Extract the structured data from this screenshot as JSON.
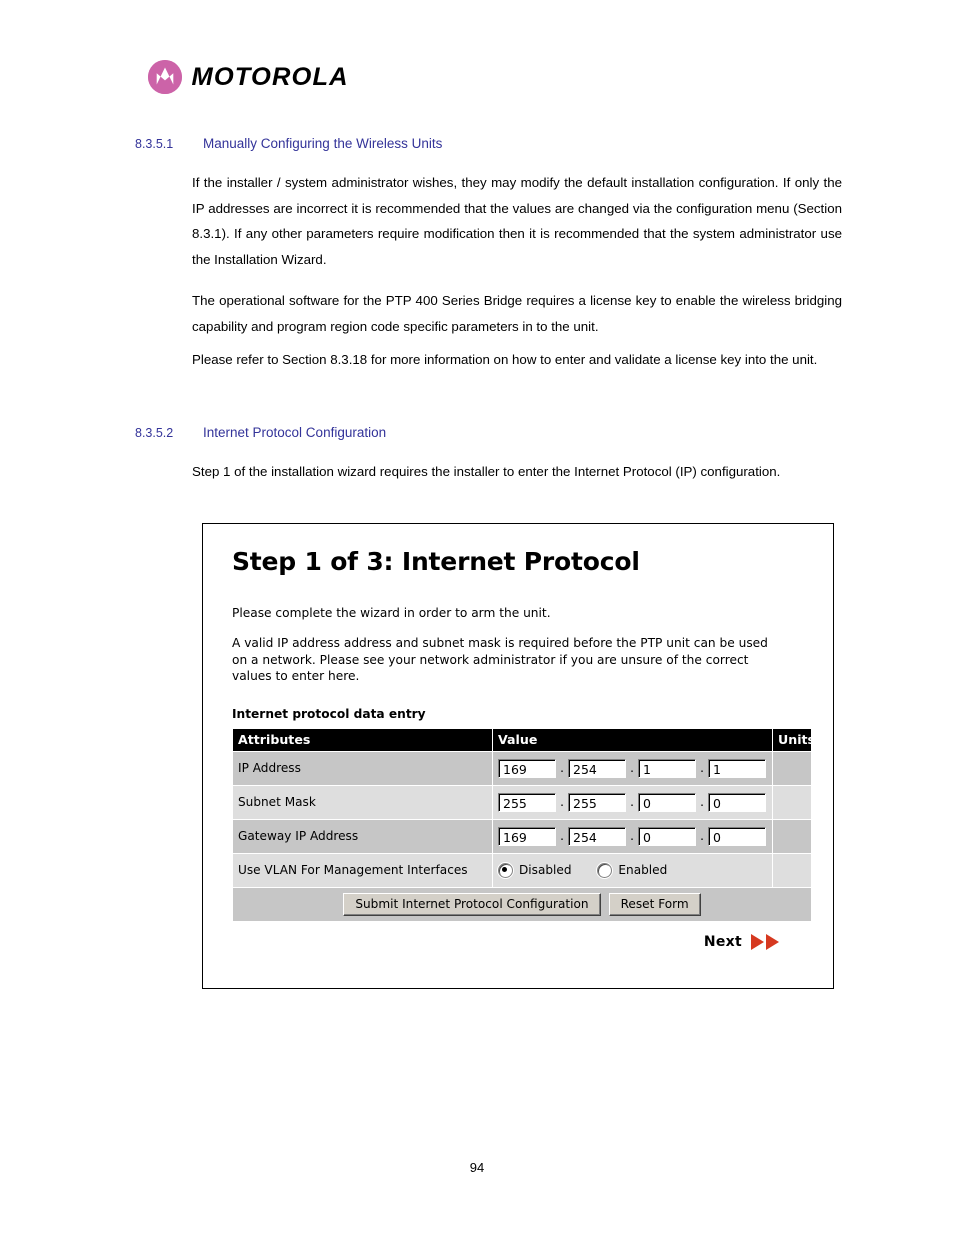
{
  "brand": {
    "name": "MOTOROLA",
    "logo_color": "#cc63a8"
  },
  "sections": [
    {
      "number": "8.3.5.1",
      "title": "Manually Configuring the Wireless Units",
      "color": "#333399"
    },
    {
      "number": "8.3.5.2",
      "title": "Internet Protocol Configuration",
      "color": "#333399"
    }
  ],
  "paragraphs": {
    "p1": "If the installer / system administrator wishes, they may modify the default installation configuration. If only the IP addresses are incorrect it is recommended that the values are changed via the configuration menu (Section 8.3.1). If any other parameters require modification then it is recommended that the system administrator use the Installation Wizard.",
    "p2": "The operational software for the PTP 400 Series Bridge requires a license key to enable the wireless bridging capability and program region code specific parameters in to the unit.",
    "p3": "Please refer to Section 8.3.18 for more information on how to enter and validate a license key into the unit.",
    "p4": "Step 1 of the installation wizard requires the installer to enter the Internet Protocol (IP) configuration."
  },
  "screenshot": {
    "title": "Step 1 of 3: Internet Protocol",
    "intro_1": "Please complete the wizard in order to arm the unit.",
    "intro_2": "A valid IP address address and subnet mask is required before the PTP unit can be used on a network. Please see your network administrator if you are unsure of the correct values to enter here.",
    "table_caption": "Internet protocol data entry",
    "columns": {
      "attributes": "Attributes",
      "value": "Value",
      "units": "Units"
    },
    "rows": [
      {
        "attribute": "IP Address",
        "octets": [
          "169",
          "254",
          "1",
          "1"
        ],
        "units": ""
      },
      {
        "attribute": "Subnet Mask",
        "octets": [
          "255",
          "255",
          "0",
          "0"
        ],
        "units": ""
      },
      {
        "attribute": "Gateway IP Address",
        "octets": [
          "169",
          "254",
          "0",
          "0"
        ],
        "units": ""
      }
    ],
    "vlan_row": {
      "attribute": "Use VLAN For Management Interfaces",
      "options": [
        {
          "label": "Disabled",
          "selected": true
        },
        {
          "label": "Enabled",
          "selected": false
        }
      ],
      "units": ""
    },
    "buttons": {
      "submit": "Submit Internet Protocol Configuration",
      "reset": "Reset Form"
    },
    "next": {
      "label": "Next",
      "arrow_color": "#d63920"
    },
    "separator": "."
  },
  "footer": {
    "page_number": "94"
  }
}
